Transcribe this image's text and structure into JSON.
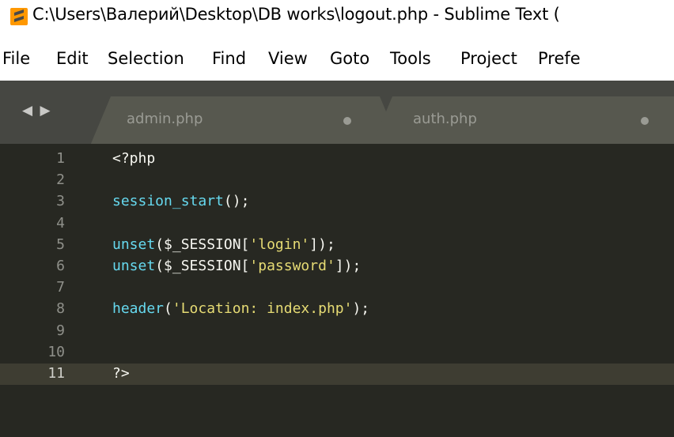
{
  "window": {
    "title": "C:\\Users\\Валерий\\Desktop\\DB works\\logout.php - Sublime Text (",
    "app_icon": "sublime-text-icon"
  },
  "menu": {
    "items": [
      "File",
      "Edit",
      "Selection",
      "Find",
      "View",
      "Goto",
      "Tools",
      "Project",
      "Prefe"
    ]
  },
  "tabs": {
    "nav_arrows": "◀ ▶",
    "items": [
      {
        "label": "admin.php",
        "dirty": true
      },
      {
        "label": "auth.php",
        "dirty": true
      }
    ]
  },
  "editor": {
    "current_line": 11,
    "colors": {
      "background": "#272822",
      "text": "#f8f8f2",
      "function": "#66d9ef",
      "string": "#e6db74",
      "gutter": "#8f908a"
    },
    "lines": [
      {
        "num": "1",
        "tokens": [
          {
            "t": "<?php",
            "k": "plain"
          }
        ]
      },
      {
        "num": "2",
        "tokens": []
      },
      {
        "num": "3",
        "tokens": [
          {
            "t": "session_start",
            "k": "func"
          },
          {
            "t": "();",
            "k": "plain"
          }
        ]
      },
      {
        "num": "4",
        "tokens": []
      },
      {
        "num": "5",
        "tokens": [
          {
            "t": "unset",
            "k": "func"
          },
          {
            "t": "($_SESSION[",
            "k": "plain"
          },
          {
            "t": "'login'",
            "k": "str"
          },
          {
            "t": "]);",
            "k": "plain"
          }
        ]
      },
      {
        "num": "6",
        "tokens": [
          {
            "t": "unset",
            "k": "func"
          },
          {
            "t": "($_SESSION[",
            "k": "plain"
          },
          {
            "t": "'password'",
            "k": "str"
          },
          {
            "t": "]);",
            "k": "plain"
          }
        ]
      },
      {
        "num": "7",
        "tokens": []
      },
      {
        "num": "8",
        "tokens": [
          {
            "t": "header",
            "k": "func"
          },
          {
            "t": "(",
            "k": "plain"
          },
          {
            "t": "'Location: index.php'",
            "k": "str"
          },
          {
            "t": ");",
            "k": "plain"
          }
        ]
      },
      {
        "num": "9",
        "tokens": []
      },
      {
        "num": "10",
        "tokens": []
      },
      {
        "num": "11",
        "tokens": [
          {
            "t": "?>",
            "k": "plain"
          }
        ]
      }
    ]
  }
}
